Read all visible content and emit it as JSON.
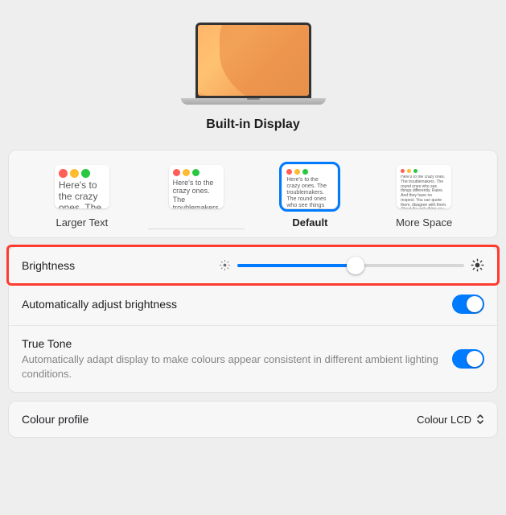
{
  "header": {
    "title": "Built-in Display"
  },
  "resolution": {
    "sample_text": "Here's to the crazy ones. The troublemakers. The round ones who see things differently. Rules. And they have no respect. You can quote them, disagree with them. About the only thing you can't do is ignore them. Because they change things.",
    "options": [
      {
        "label": "Larger Text",
        "selected": false
      },
      {
        "label": "",
        "selected": false
      },
      {
        "label": "Default",
        "selected": true
      },
      {
        "label": "More Space",
        "selected": false
      }
    ]
  },
  "brightness": {
    "label": "Brightness",
    "value_percent": 52
  },
  "auto_brightness": {
    "label": "Automatically adjust brightness",
    "enabled": true
  },
  "true_tone": {
    "label": "True Tone",
    "description": "Automatically adapt display to make colours appear consistent in different ambient lighting conditions.",
    "enabled": true
  },
  "colour_profile": {
    "label": "Colour profile",
    "value": "Colour LCD"
  }
}
